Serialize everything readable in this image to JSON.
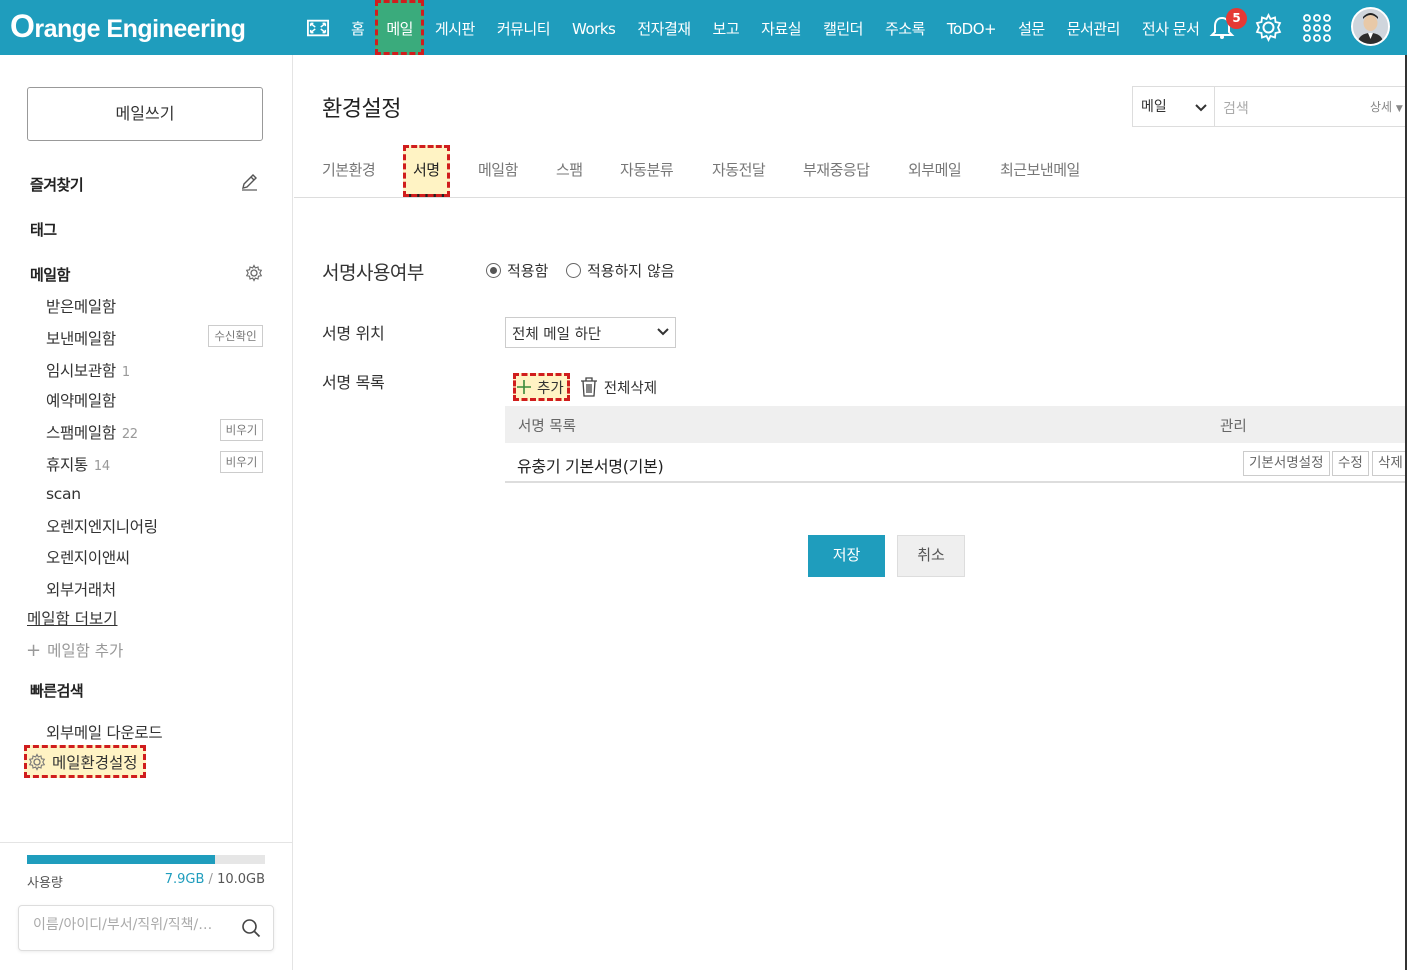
{
  "brand": {
    "logo_first": "O",
    "logo_rest": "range Engineering"
  },
  "nav": {
    "items": [
      "홈",
      "메일",
      "게시판",
      "커뮤니티",
      "Works",
      "전자결재",
      "보고",
      "자료실",
      "캘린더",
      "주소록",
      "ToDO+",
      "설문",
      "문서관리",
      "전사 문서"
    ],
    "active": "메일",
    "notification_count": "5"
  },
  "sidebar": {
    "compose_label": "메일쓰기",
    "favorites_label": "즐겨찾기",
    "tags_label": "태그",
    "mailbox_label": "메일함",
    "mailboxes": [
      {
        "label": "받은메일함",
        "count": "",
        "button": ""
      },
      {
        "label": "보낸메일함",
        "count": "",
        "button": "수신확인"
      },
      {
        "label": "임시보관함",
        "count": "1",
        "button": ""
      },
      {
        "label": "예약메일함",
        "count": "",
        "button": ""
      },
      {
        "label": "스팸메일함",
        "count": "22",
        "button": "비우기"
      },
      {
        "label": "휴지통",
        "count": "14",
        "button": "비우기"
      },
      {
        "label": "scan",
        "count": "",
        "button": ""
      },
      {
        "label": "오렌지엔지니어링",
        "count": "",
        "button": ""
      },
      {
        "label": "오렌지이앤씨",
        "count": "",
        "button": ""
      },
      {
        "label": "외부거래처",
        "count": "",
        "button": ""
      }
    ],
    "more_label": "메일함 더보기",
    "add_label": "메일함 추가",
    "quick_search_label": "빠른검색",
    "external_download": "외부메일 다운로드",
    "settings_label": "메일환경설정",
    "usage_label": "사용량",
    "usage_used": "7.9GB",
    "usage_sep": "/",
    "usage_total": "10.0GB",
    "usage_fraction": 0.79,
    "people_search_placeholder": "이름/아이디/부서/직위/직책/…"
  },
  "main": {
    "title": "환경설정",
    "search_scope": "메일",
    "search_placeholder": "검색",
    "search_detail": "상세",
    "tabs": [
      "기본환경",
      "서명",
      "메일함",
      "스팸",
      "자동분류",
      "자동전달",
      "부재중응답",
      "외부메일",
      "최근보낸메일"
    ],
    "active_tab": "서명",
    "signature_use_label": "서명사용여부",
    "radio_apply": "적용함",
    "radio_not_apply": "적용하지 않음",
    "position_label": "서명 위치",
    "position_value": "전체 메일 하단",
    "list_label": "서명 목록",
    "add_label": "추가",
    "delete_all_label": "전체삭제",
    "table_headers": [
      "서명 목록",
      "관리"
    ],
    "signatures": [
      {
        "name": "유충기 기본서명(기본)",
        "actions": [
          "기본서명설정",
          "수정",
          "삭제"
        ]
      }
    ],
    "save_label": "저장",
    "cancel_label": "취소"
  },
  "colors": {
    "brand": "#1f9dbd",
    "active_nav": "#3aab7c",
    "highlight": "#d01d1d"
  }
}
